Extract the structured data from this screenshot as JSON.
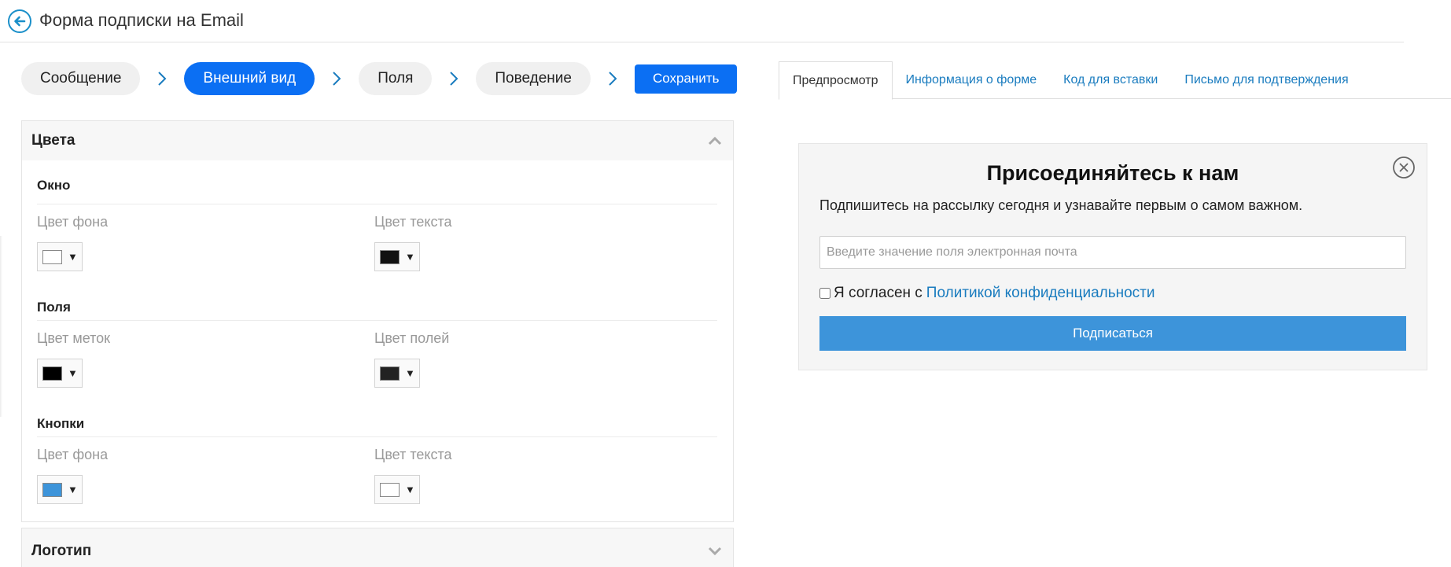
{
  "header": {
    "title": "Форма подписки на Email"
  },
  "steps": [
    {
      "label": "Сообщение",
      "active": false
    },
    {
      "label": "Внешний вид",
      "active": true
    },
    {
      "label": "Поля",
      "active": false
    },
    {
      "label": "Поведение",
      "active": false
    }
  ],
  "save_label": "Сохранить",
  "colors_panel": {
    "title": "Цвета",
    "sections": [
      {
        "title": "Окно",
        "items": [
          {
            "label": "Цвет фона",
            "color": "#ffffff"
          },
          {
            "label": "Цвет текста",
            "color": "#111111"
          }
        ]
      },
      {
        "title": "Поля",
        "items": [
          {
            "label": "Цвет меток",
            "color": "#000000"
          },
          {
            "label": "Цвет полей",
            "color": "#222222"
          }
        ]
      },
      {
        "title": "Кнопки",
        "items": [
          {
            "label": "Цвет фона",
            "color": "#3d94da"
          },
          {
            "label": "Цвет текста",
            "color": "#ffffff"
          }
        ]
      }
    ]
  },
  "logo_panel": {
    "title": "Логотип"
  },
  "tabs": [
    {
      "label": "Предпросмотр",
      "active": true
    },
    {
      "label": "Информация о форме",
      "active": false
    },
    {
      "label": "Код для вставки",
      "active": false
    },
    {
      "label": "Письмо для подтверждения",
      "active": false
    }
  ],
  "preview": {
    "title": "Присоединяйтесь к нам",
    "subtitle": "Подпишитесь на рассылку сегодня и узнавайте первым о самом важном.",
    "email_placeholder": "Введите значение поля электронная почта",
    "agree_text": "Я согласен с",
    "agree_link": "Политикой конфиденциальности",
    "subscribe_label": "Подписаться"
  },
  "theme": {
    "accent": "#0b6ff3",
    "link": "#1a7cbf",
    "button": "#3d94da"
  }
}
